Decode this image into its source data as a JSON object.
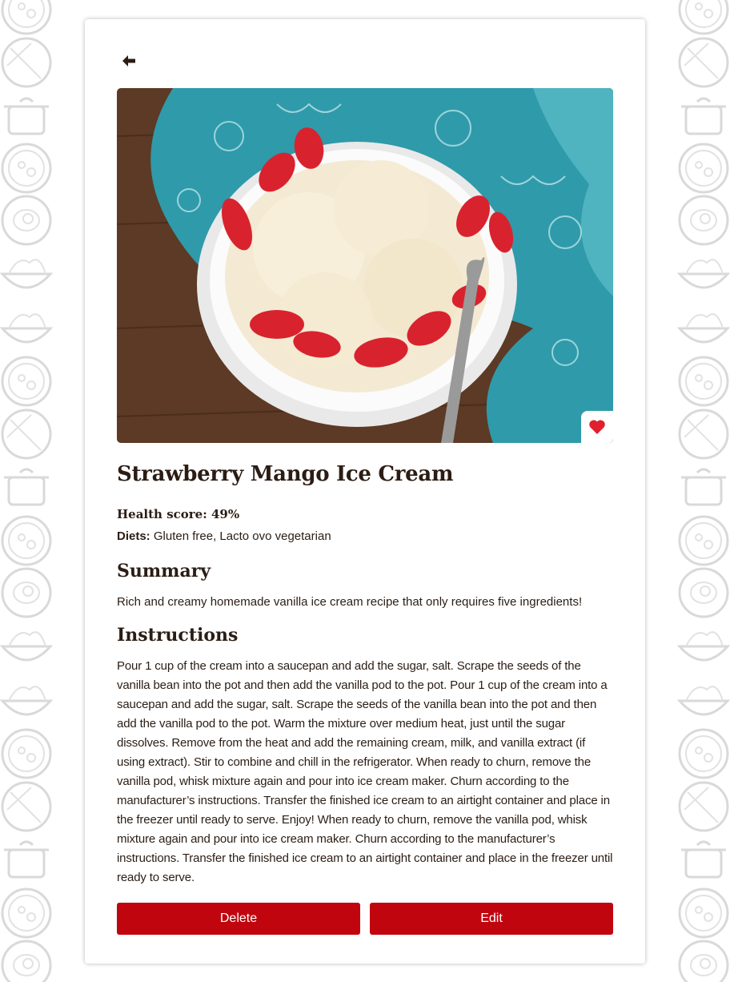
{
  "recipe": {
    "title": "Strawberry Mango Ice Cream",
    "health_label": "Health score:",
    "health_value": "49%",
    "diets_label": "Diets:",
    "diets_value": "Gluten free, Lacto ovo vegetarian",
    "favorite": true
  },
  "summary": {
    "heading": "Summary",
    "text": "Rich and creamy homemade vanilla ice cream recipe that only requires five ingredients!"
  },
  "instructions": {
    "heading": "Instructions",
    "text": "Pour 1 cup of the cream into a saucepan and add the sugar, salt. Scrape the seeds of the vanilla bean into the pot and then add the vanilla pod to the pot. Pour 1 cup of the cream into a saucepan and add the sugar, salt. Scrape the seeds of the vanilla bean into the pot and then add the vanilla pod to the pot. Warm the mixture over medium heat, just until the sugar dissolves. Remove from the heat and add the remaining cream, milk, and vanilla extract (if using extract). Stir to combine and chill in the refrigerator. When ready to churn, remove the vanilla pod, whisk mixture again and pour into ice cream maker. Churn according to the manufacturer’s instructions. Transfer the finished ice cream to an airtight container and place in the freezer until ready to serve. Enjoy! When ready to churn, remove the vanilla pod, whisk mixture again and pour into ice cream maker. Churn according to the manufacturer’s instructions. Transfer the finished ice cream to an airtight container and place in the freezer until ready to serve."
  },
  "actions": {
    "delete_label": "Delete",
    "edit_label": "Edit"
  },
  "icons": {
    "back": "arrow-left-icon",
    "favorite": "heart-icon"
  },
  "colors": {
    "accent": "#c1050f",
    "text": "#2b1d14",
    "heart": "#e0202f",
    "pattern_stroke": "#d9d9d9"
  }
}
